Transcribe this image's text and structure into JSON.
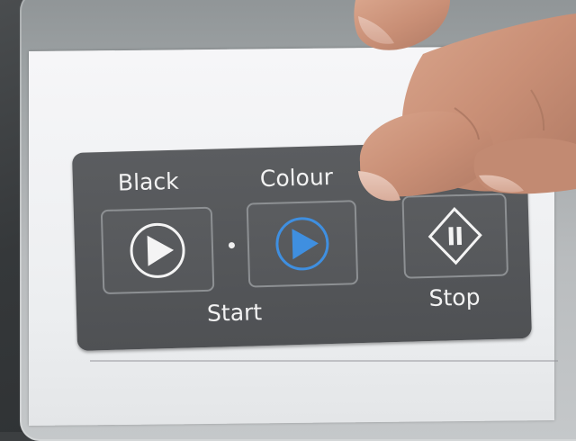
{
  "panel": {
    "black_label": "Black",
    "colour_label": "Colour",
    "start_label": "Start",
    "stop_label": "Stop"
  },
  "icons": {
    "black_start": "play-circle-white-icon",
    "colour_start": "play-circle-blue-icon",
    "stop": "diamond-pause-icon"
  },
  "colors": {
    "panel": "#545659",
    "label_text": "#f2f2f2",
    "colour_accent": "#3f8fe0"
  }
}
